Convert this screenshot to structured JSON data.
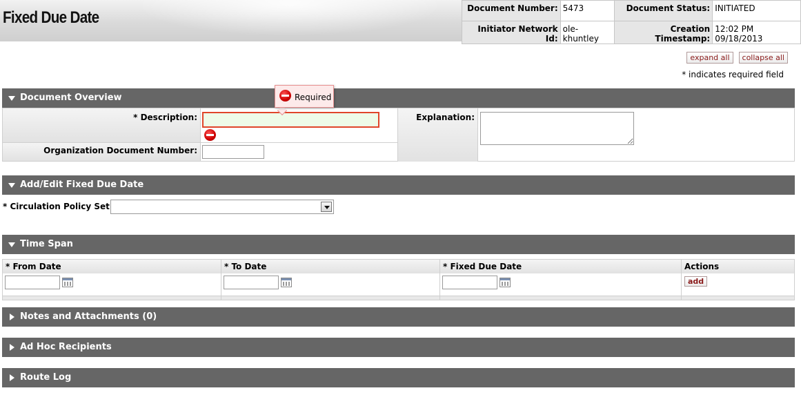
{
  "header": {
    "title": "Fixed Due Date",
    "doc_number_label": "Document Number:",
    "doc_number": "5473",
    "doc_status_label": "Document Status:",
    "doc_status": "INITIATED",
    "initiator_label": "Initiator Network Id:",
    "initiator": "ole-khuntley",
    "timestamp_label": "Creation Timestamp:",
    "timestamp": "12:02 PM 09/18/2013"
  },
  "top_links": {
    "expand_all": "expand all",
    "collapse_all": "collapse all",
    "required_note": "* indicates required field"
  },
  "sections": {
    "document_overview": "Document Overview",
    "add_edit": "Add/Edit Fixed Due Date",
    "time_span": "Time Span",
    "notes": "Notes and Attachments (0)",
    "adhoc": "Ad Hoc Recipients",
    "route_log": "Route Log"
  },
  "overview": {
    "description_label": "* Description:",
    "description_value": "",
    "org_doc_label": "Organization Document Number:",
    "org_doc_value": "",
    "explanation_label": "Explanation:",
    "explanation_value": "",
    "tooltip": "Required"
  },
  "circulation": {
    "label": "* Circulation Policy Set:",
    "selected": ""
  },
  "time_span": {
    "columns": [
      "* From Date",
      "* To Date",
      "* Fixed Due Date",
      "Actions"
    ],
    "add_label": "add"
  },
  "colors": {
    "section_bar": "#666666",
    "error_border": "#e0452a",
    "link_text": "#8a1a1a"
  },
  "icons": [
    "stop-error-icon",
    "calendar-icon",
    "triangle-down-icon",
    "triangle-right-icon",
    "dropdown-arrow-icon"
  ]
}
